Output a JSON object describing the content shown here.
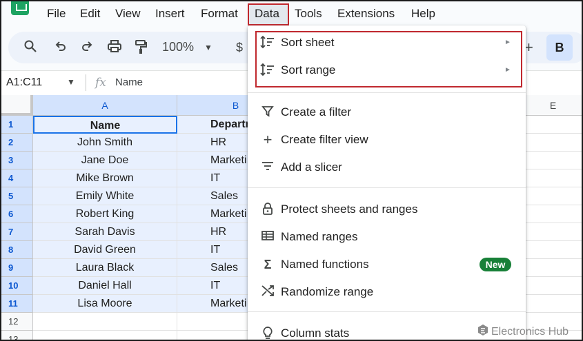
{
  "menubar": {
    "items": [
      "File",
      "Edit",
      "View",
      "Insert",
      "Format",
      "Data",
      "Tools",
      "Extensions",
      "Help"
    ]
  },
  "toolbar": {
    "zoom": "100%",
    "currency": "$",
    "bold": "B",
    "plus": "+"
  },
  "formula_bar": {
    "range": "A1:C11",
    "fx": "fx",
    "value": "Name"
  },
  "grid": {
    "columns": [
      "A",
      "B",
      "E"
    ],
    "rows": [
      {
        "num": "1",
        "name": "Name",
        "dept": "Departm"
      },
      {
        "num": "2",
        "name": "John Smith",
        "dept": "HR"
      },
      {
        "num": "3",
        "name": "Jane Doe",
        "dept": "Marketi"
      },
      {
        "num": "4",
        "name": "Mike Brown",
        "dept": "IT"
      },
      {
        "num": "5",
        "name": "Emily White",
        "dept": "Sales"
      },
      {
        "num": "6",
        "name": "Robert King",
        "dept": "Marketi"
      },
      {
        "num": "7",
        "name": "Sarah Davis",
        "dept": "HR"
      },
      {
        "num": "8",
        "name": "David Green",
        "dept": "IT"
      },
      {
        "num": "9",
        "name": "Laura Black",
        "dept": "Sales"
      },
      {
        "num": "10",
        "name": "Daniel Hall",
        "dept": "IT"
      },
      {
        "num": "11",
        "name": "Lisa Moore",
        "dept": "Marketi"
      },
      {
        "num": "12",
        "name": "",
        "dept": ""
      },
      {
        "num": "13",
        "name": "",
        "dept": ""
      }
    ]
  },
  "data_menu": {
    "items": [
      {
        "label": "Sort sheet",
        "icon": "sort-icon",
        "arrow": "►"
      },
      {
        "label": "Sort range",
        "icon": "sort-icon",
        "arrow": "►"
      },
      {
        "label": "Create a filter",
        "icon": "filter-icon"
      },
      {
        "label": "Create filter view",
        "icon": "plus-icon"
      },
      {
        "label": "Add a slicer",
        "icon": "slicer-icon"
      },
      {
        "label": "Protect sheets and ranges",
        "icon": "lock-icon"
      },
      {
        "label": "Named ranges",
        "icon": "table-icon"
      },
      {
        "label": "Named functions",
        "icon": "sigma-icon",
        "badge": "New"
      },
      {
        "label": "Randomize range",
        "icon": "shuffle-icon"
      },
      {
        "label": "Column stats",
        "icon": "bulb-icon"
      }
    ]
  },
  "watermark": {
    "text": "Electronics Hub"
  },
  "colors": {
    "highlight_box": "#c0282e",
    "selection": "#e8f0fe",
    "badge": "#188038",
    "logo": "#1ea362"
  }
}
